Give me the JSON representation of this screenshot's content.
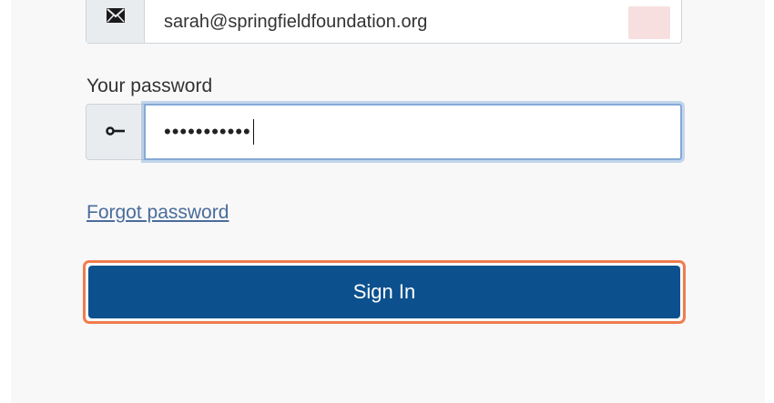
{
  "email": {
    "value": "sarah@springfieldfoundation.org",
    "icon": "envelope-icon"
  },
  "password": {
    "label": "Your password",
    "masked_value": "•••••••••••",
    "icon": "key-icon"
  },
  "forgot_link": "Forgot password",
  "sign_in": {
    "label": "Sign In",
    "color": "#0c518e",
    "focus_ring_color": "#f07c4e"
  },
  "colors": {
    "link": "#4a6c9c",
    "input_focus": "#86a9d6"
  }
}
